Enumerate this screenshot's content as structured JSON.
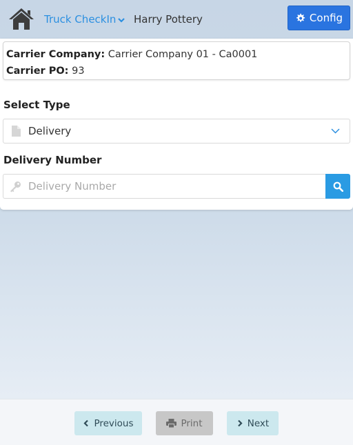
{
  "header": {
    "module": "Truck CheckIn",
    "company": "Harry Pottery",
    "config_label": "Config",
    "accent_color": "#2a74e0"
  },
  "carrier": {
    "company_label": "Carrier Company:",
    "company_value": "Carrier Company 01 - Ca0001",
    "po_label": "Carrier PO:",
    "po_value": "93"
  },
  "form": {
    "select_type_label": "Select Type",
    "select_type_value": "Delivery",
    "delivery_number_label": "Delivery Number",
    "delivery_number_placeholder": "Delivery Number",
    "delivery_number_value": ""
  },
  "footer": {
    "previous_label": "Previous",
    "print_label": "Print",
    "next_label": "Next"
  },
  "icons": {
    "home": "home-icon",
    "module_dropdown": "chevron-down-icon",
    "config": "gear-icon",
    "document": "document-icon",
    "select_caret": "chevron-down-icon",
    "key": "key-icon",
    "search": "search-icon",
    "previous": "chevron-left-icon",
    "print": "printer-icon",
    "next": "chevron-right-icon"
  }
}
